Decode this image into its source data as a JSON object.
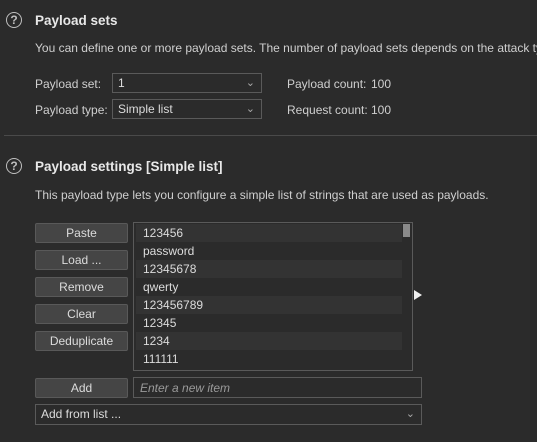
{
  "payload_sets": {
    "title": "Payload sets",
    "description": "You can define one or more payload sets. The number of payload sets depends on the attack type",
    "set_label": "Payload set:",
    "set_value": "1",
    "type_label": "Payload type:",
    "type_value": "Simple list",
    "payload_count_label": "Payload count:",
    "payload_count": "100",
    "request_count_label": "Request count:",
    "request_count": "100"
  },
  "payload_settings": {
    "title": "Payload settings [Simple list]",
    "description": "This payload type lets you configure a simple list of strings that are used as payloads.",
    "buttons": {
      "paste": "Paste",
      "load": "Load ...",
      "remove": "Remove",
      "clear": "Clear",
      "deduplicate": "Deduplicate",
      "add": "Add"
    },
    "items": [
      "123456",
      "password",
      "12345678",
      "qwerty",
      "123456789",
      "12345",
      "1234",
      "111111"
    ],
    "new_item_placeholder": "Enter a new item",
    "add_from_list": "Add from list ..."
  },
  "icons": {
    "help": "help-circle-icon",
    "dropdown": "chevron-down-icon",
    "cursor": "mouse-pointer-icon"
  }
}
